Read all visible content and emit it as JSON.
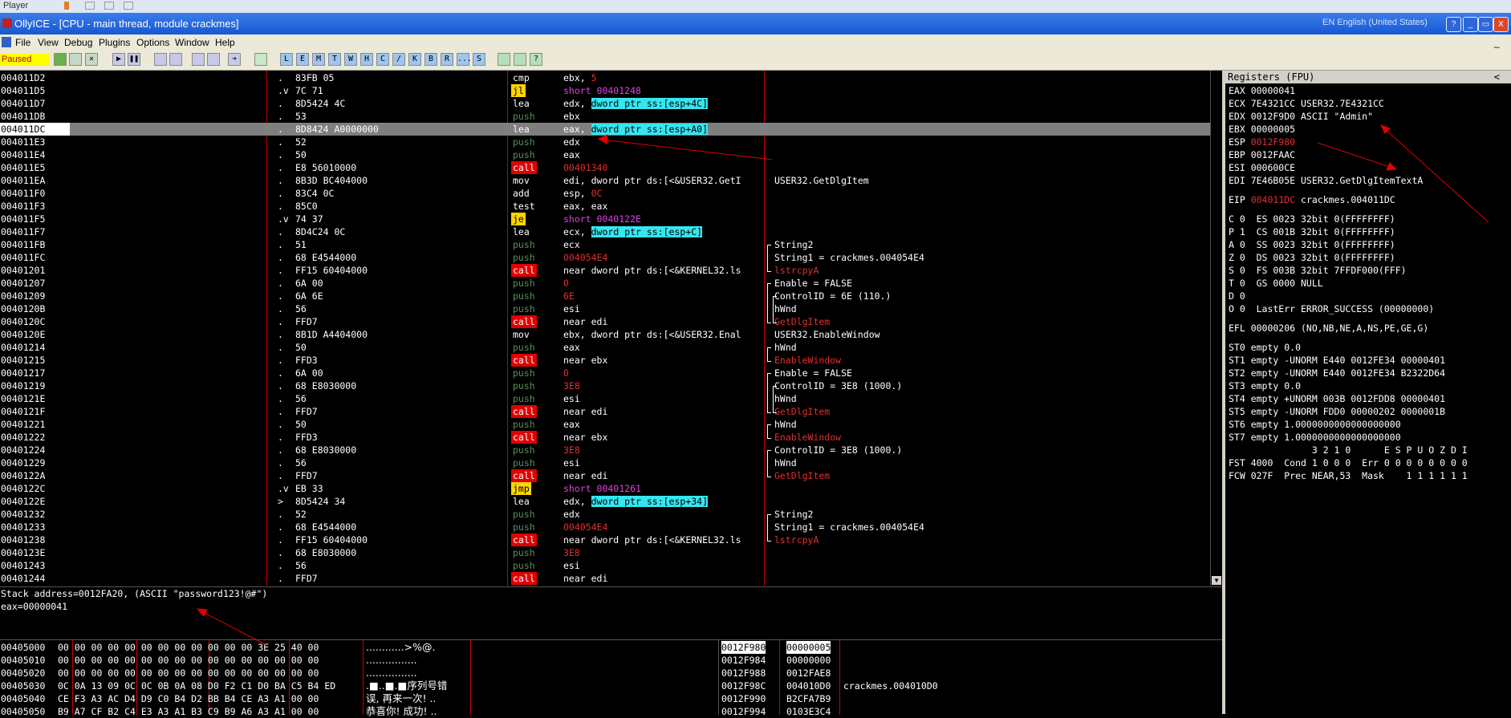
{
  "top_strip": {
    "label": "Player"
  },
  "title_bar": {
    "title": "OllyICE - [CPU - main thread, module crackmes]",
    "language": "EN English (United States)",
    "help": "?",
    "min": "_",
    "restore": "▭",
    "close": "X"
  },
  "menu": [
    "File",
    "View",
    "Debug",
    "Plugins",
    "Options",
    "Window",
    "Help"
  ],
  "status": "Paused",
  "toolbar": {
    "letters": [
      "L",
      "E",
      "M",
      "T",
      "W",
      "H",
      "C",
      "/",
      "K",
      "B",
      "R",
      "...",
      "S"
    ]
  },
  "disasm": [
    {
      "addr": "004011D2",
      "mark": ".",
      "hex": "83FB 05",
      "mn": "cmp",
      "mt": "def",
      "op": "ebx, 5",
      "ot": "mix",
      "op_pre": "ebx, ",
      "op_hl": "5",
      "cm": "",
      "ct": "def"
    },
    {
      "addr": "004011D5",
      "mark": ".v",
      "hex": "7C 71",
      "mn": "jl",
      "mt": "j",
      "op": "short 00401248",
      "ot": "mag",
      "cm": "",
      "ct": "def"
    },
    {
      "addr": "004011D7",
      "mark": ".",
      "hex": "8D5424 4C",
      "mn": "lea",
      "mt": "def",
      "op_pre": "edx, ",
      "op_hl": "dword ptr ss:[esp+4C]",
      "ot": "hl",
      "cm": "",
      "ct": "def"
    },
    {
      "addr": "004011DB",
      "mark": ".",
      "hex": "53",
      "mn": "push",
      "mt": "push",
      "op": "ebx",
      "ot": "def",
      "cm": "",
      "ct": "def"
    },
    {
      "addr": "004011DC",
      "mark": ".",
      "hex": "8D8424 A0000000",
      "mn": "lea",
      "mt": "def",
      "op_pre": "eax, ",
      "op_hl": "dword ptr ss:[esp+A0]",
      "ot": "hl",
      "cm": "",
      "ct": "def",
      "sel": true
    },
    {
      "addr": "004011E3",
      "mark": ".",
      "hex": "52",
      "mn": "push",
      "mt": "push",
      "op": "edx",
      "ot": "def",
      "cm": "",
      "ct": "def"
    },
    {
      "addr": "004011E4",
      "mark": ".",
      "hex": "50",
      "mn": "push",
      "mt": "push",
      "op": "eax",
      "ot": "def",
      "cm": "",
      "ct": "def"
    },
    {
      "addr": "004011E5",
      "mark": ".",
      "hex": "E8 56010000",
      "mn": "call",
      "mt": "call",
      "op": "00401340",
      "ot": "red",
      "cm": "",
      "ct": "def"
    },
    {
      "addr": "004011EA",
      "mark": ".",
      "hex": "8B3D BC404000",
      "mn": "mov",
      "mt": "def",
      "op": "edi, dword ptr ds:[<&USER32.GetI",
      "ot": "def",
      "cm": "USER32.GetDlgItem",
      "ct": "def"
    },
    {
      "addr": "004011F0",
      "mark": ".",
      "hex": "83C4 0C",
      "mn": "add",
      "mt": "def",
      "op": "esp, 0C",
      "ot": "mix",
      "op_pre": "esp, ",
      "op_red": "0C",
      "cm": "",
      "ct": "def"
    },
    {
      "addr": "004011F3",
      "mark": ".",
      "hex": "85C0",
      "mn": "test",
      "mt": "def",
      "op": "eax, eax",
      "ot": "def",
      "cm": "",
      "ct": "def"
    },
    {
      "addr": "004011F5",
      "mark": ".v",
      "hex": "74 37",
      "mn": "je",
      "mt": "j",
      "op": "short 0040122E",
      "ot": "mag",
      "cm": "",
      "ct": "def"
    },
    {
      "addr": "004011F7",
      "mark": ".",
      "hex": "8D4C24 0C",
      "mn": "lea",
      "mt": "def",
      "op_pre": "ecx, ",
      "op_hl": "dword ptr ss:[esp+C]",
      "ot": "hl",
      "cm": "",
      "ct": "def"
    },
    {
      "addr": "004011FB",
      "mark": ".",
      "hex": "51",
      "mn": "push",
      "mt": "push",
      "op": "ecx",
      "ot": "def",
      "cm": "String2",
      "ct": "def"
    },
    {
      "addr": "004011FC",
      "mark": ".",
      "hex": "68 E4544000",
      "mn": "push",
      "mt": "push",
      "op": "004054E4",
      "ot": "red",
      "cm": "String1 = crackmes.004054E4",
      "ct": "def"
    },
    {
      "addr": "00401201",
      "mark": ".",
      "hex": "FF15 60404000",
      "mn": "call",
      "mt": "call",
      "op": "near dword ptr ds:[<&KERNEL32.ls",
      "ot": "def",
      "cm": "lstrcpyA",
      "ct": "fn"
    },
    {
      "addr": "00401207",
      "mark": ".",
      "hex": "6A 00",
      "mn": "push",
      "mt": "push",
      "op": "0",
      "ot": "red",
      "cm": "Enable = FALSE",
      "ct": "def"
    },
    {
      "addr": "00401209",
      "mark": ".",
      "hex": "6A 6E",
      "mn": "push",
      "mt": "push",
      "op": "6E",
      "ot": "red",
      "cm": "ControlID = 6E (110.)",
      "ct": "def"
    },
    {
      "addr": "0040120B",
      "mark": ".",
      "hex": "56",
      "mn": "push",
      "mt": "push",
      "op": "esi",
      "ot": "def",
      "cm": "hWnd",
      "ct": "def"
    },
    {
      "addr": "0040120C",
      "mark": ".",
      "hex": "FFD7",
      "mn": "call",
      "mt": "call",
      "op": "near edi",
      "ot": "def",
      "cm": "GetDlgItem",
      "ct": "fn"
    },
    {
      "addr": "0040120E",
      "mark": ".",
      "hex": "8B1D A4404000",
      "mn": "mov",
      "mt": "def",
      "op": "ebx, dword ptr ds:[<&USER32.Enal",
      "ot": "def",
      "cm": "USER32.EnableWindow",
      "ct": "def"
    },
    {
      "addr": "00401214",
      "mark": ".",
      "hex": "50",
      "mn": "push",
      "mt": "push",
      "op": "eax",
      "ot": "def",
      "cm": "hWnd",
      "ct": "def"
    },
    {
      "addr": "00401215",
      "mark": ".",
      "hex": "FFD3",
      "mn": "call",
      "mt": "call",
      "op": "near ebx",
      "ot": "def",
      "cm": "EnableWindow",
      "ct": "fn"
    },
    {
      "addr": "00401217",
      "mark": ".",
      "hex": "6A 00",
      "mn": "push",
      "mt": "push",
      "op": "0",
      "ot": "red",
      "cm": "Enable = FALSE",
      "ct": "def"
    },
    {
      "addr": "00401219",
      "mark": ".",
      "hex": "68 E8030000",
      "mn": "push",
      "mt": "push",
      "op": "3E8",
      "ot": "red",
      "cm": "ControlID = 3E8 (1000.)",
      "ct": "def"
    },
    {
      "addr": "0040121E",
      "mark": ".",
      "hex": "56",
      "mn": "push",
      "mt": "push",
      "op": "esi",
      "ot": "def",
      "cm": "hWnd",
      "ct": "def"
    },
    {
      "addr": "0040121F",
      "mark": ".",
      "hex": "FFD7",
      "mn": "call",
      "mt": "call",
      "op": "near edi",
      "ot": "def",
      "cm": "GetDlgItem",
      "ct": "fn"
    },
    {
      "addr": "00401221",
      "mark": ".",
      "hex": "50",
      "mn": "push",
      "mt": "push",
      "op": "eax",
      "ot": "def",
      "cm": "hWnd",
      "ct": "def"
    },
    {
      "addr": "00401222",
      "mark": ".",
      "hex": "FFD3",
      "mn": "call",
      "mt": "call",
      "op": "near ebx",
      "ot": "def",
      "cm": "EnableWindow",
      "ct": "fn"
    },
    {
      "addr": "00401224",
      "mark": ".",
      "hex": "68 E8030000",
      "mn": "push",
      "mt": "push",
      "op": "3E8",
      "ot": "red",
      "cm": "ControlID = 3E8 (1000.)",
      "ct": "def"
    },
    {
      "addr": "00401229",
      "mark": ".",
      "hex": "56",
      "mn": "push",
      "mt": "push",
      "op": "esi",
      "ot": "def",
      "cm": "hWnd",
      "ct": "def"
    },
    {
      "addr": "0040122A",
      "mark": ".",
      "hex": "FFD7",
      "mn": "call",
      "mt": "call",
      "op": "near edi",
      "ot": "def",
      "cm": "GetDlgItem",
      "ct": "fn"
    },
    {
      "addr": "0040122C",
      "mark": ".v",
      "hex": "EB 33",
      "mn": "jmp",
      "mt": "j",
      "op": "short 00401261",
      "ot": "mag",
      "cm": "",
      "ct": "def"
    },
    {
      "addr": "0040122E",
      "mark": ">",
      "hex": "8D5424 34",
      "mn": "lea",
      "mt": "def",
      "op_pre": "edx, ",
      "op_hl": "dword ptr ss:[esp+34]",
      "ot": "hl",
      "cm": "",
      "ct": "def"
    },
    {
      "addr": "00401232",
      "mark": ".",
      "hex": "52",
      "mn": "push",
      "mt": "push",
      "op": "edx",
      "ot": "def",
      "cm": "String2",
      "ct": "def"
    },
    {
      "addr": "00401233",
      "mark": ".",
      "hex": "68 E4544000",
      "mn": "push",
      "mt": "push",
      "op": "004054E4",
      "ot": "red",
      "cm": "String1 = crackmes.004054E4",
      "ct": "def"
    },
    {
      "addr": "00401238",
      "mark": ".",
      "hex": "FF15 60404000",
      "mn": "call",
      "mt": "call",
      "op": "near dword ptr ds:[<&KERNEL32.ls",
      "ot": "def",
      "cm": "lstrcpyA",
      "ct": "fn"
    },
    {
      "addr": "0040123E",
      "mark": ".",
      "hex": "68 E8030000",
      "mn": "push",
      "mt": "push",
      "op": "3E8",
      "ot": "red",
      "cm": "",
      "ct": "def"
    },
    {
      "addr": "00401243",
      "mark": ".",
      "hex": "56",
      "mn": "push",
      "mt": "push",
      "op": "esi",
      "ot": "def",
      "cm": "",
      "ct": "def"
    },
    {
      "addr": "00401244",
      "mark": ".",
      "hex": "FFD7",
      "mn": "call",
      "mt": "call",
      "op": "near edi",
      "ot": "def",
      "cm": "",
      "ct": "def"
    }
  ],
  "registers": {
    "title": "Registers (FPU)",
    "lines": [
      {
        "t": "EAX 00000041"
      },
      {
        "t": "ECX 7E4321CC USER32.7E4321CC"
      },
      {
        "t": "EDX 0012F9D0 ASCII \"Admin\""
      },
      {
        "t": "EBX 00000005"
      },
      {
        "p": "ESP ",
        "r": "0012F980",
        "s": ""
      },
      {
        "t": "EBP 0012FAAC"
      },
      {
        "t": "ESI 000600CE"
      },
      {
        "t": "EDI 7E46B05E USER32.GetDlgItemTextA"
      },
      {
        "t": ""
      },
      {
        "p": "EIP ",
        "r": "004011DC",
        "s": " crackmes.004011DC"
      },
      {
        "t": ""
      },
      {
        "t": "C 0  ES 0023 32bit 0(FFFFFFFF)"
      },
      {
        "t": "P 1  CS 001B 32bit 0(FFFFFFFF)"
      },
      {
        "t": "A 0  SS 0023 32bit 0(FFFFFFFF)"
      },
      {
        "t": "Z 0  DS 0023 32bit 0(FFFFFFFF)"
      },
      {
        "t": "S 0  FS 003B 32bit 7FFDF000(FFF)"
      },
      {
        "t": "T 0  GS 0000 NULL"
      },
      {
        "t": "D 0"
      },
      {
        "t": "O 0  LastErr ERROR_SUCCESS (00000000)"
      },
      {
        "t": ""
      },
      {
        "t": "EFL 00000206 (NO,NB,NE,A,NS,PE,GE,G)"
      },
      {
        "t": ""
      },
      {
        "t": "ST0 empty 0.0"
      },
      {
        "t": "ST1 empty -UNORM E440 0012FE34 00000401"
      },
      {
        "t": "ST2 empty -UNORM E440 0012FE34 B2322D64"
      },
      {
        "t": "ST3 empty 0.0"
      },
      {
        "t": "ST4 empty +UNORM 003B 0012FDD8 00000401"
      },
      {
        "t": "ST5 empty -UNORM FDD0 00000202 0000001B"
      },
      {
        "t": "ST6 empty 1.0000000000000000000"
      },
      {
        "t": "ST7 empty 1.0000000000000000000"
      },
      {
        "t": "               3 2 1 0      E S P U O Z D I"
      },
      {
        "t": "FST 4000  Cond 1 0 0 0  Err 0 0 0 0 0 0 0 0"
      },
      {
        "t": "FCW 027F  Prec NEAR,53  Mask    1 1 1 1 1 1"
      }
    ]
  },
  "info": {
    "line1": "Stack address=0012FA20, (ASCII \"password123!@#\")",
    "line2": "eax=00000041"
  },
  "dump": [
    {
      "a": "00405000",
      "h": "00 00 00 00 00 00 00 00 00 00 00 00 3E 25 40 00",
      "s": "............>%@."
    },
    {
      "a": "00405010",
      "h": "00 00 00 00 00 00 00 00 00 00 00 00 00 00 00 00",
      "s": "................"
    },
    {
      "a": "00405020",
      "h": "00 00 00 00 00 00 00 00 00 00 00 00 00 00 00 00",
      "s": "................"
    },
    {
      "a": "00405030",
      "h": "0C 0A 13 09 0C 0C 0B 0A 08 D0 F2 C1 D0 BA C5 B4 ED",
      "s": ".■..■.■序列号错"
    },
    {
      "a": "00405040",
      "h": "CE F3 A3 AC D4 D9 C0 B4 D2 BB B4 CE A3 A1 00 00",
      "s": "误, 再来一次! .."
    },
    {
      "a": "00405050",
      "h": "B9 A7 CF B2 C4 E3 A3 A1 B3 C9 B9 A6 A3 A1 00 00",
      "s": "恭喜你! 成功! .."
    }
  ],
  "stack": [
    {
      "a": "0012F980",
      "v": "00000005",
      "c": ""
    },
    {
      "a": "0012F984",
      "v": "00000000",
      "c": ""
    },
    {
      "a": "0012F988",
      "v": "0012FAE8",
      "c": ""
    },
    {
      "a": "0012F98C",
      "v": "004010D0",
      "c": "crackmes.004010D0"
    },
    {
      "a": "0012F990",
      "v": "B2CFA7B9",
      "c": ""
    },
    {
      "a": "0012F994",
      "v": "0103E3C4",
      "c": ""
    }
  ],
  "colors": {
    "call": "#e00000",
    "push": "#5a8f5a",
    "jump": "#ffd400",
    "highlight": "#35e6f0",
    "selection": "#7f7f7f",
    "red_text": "#e03030",
    "magenta_text": "#e040e0",
    "title_bar": "#1758d4"
  }
}
